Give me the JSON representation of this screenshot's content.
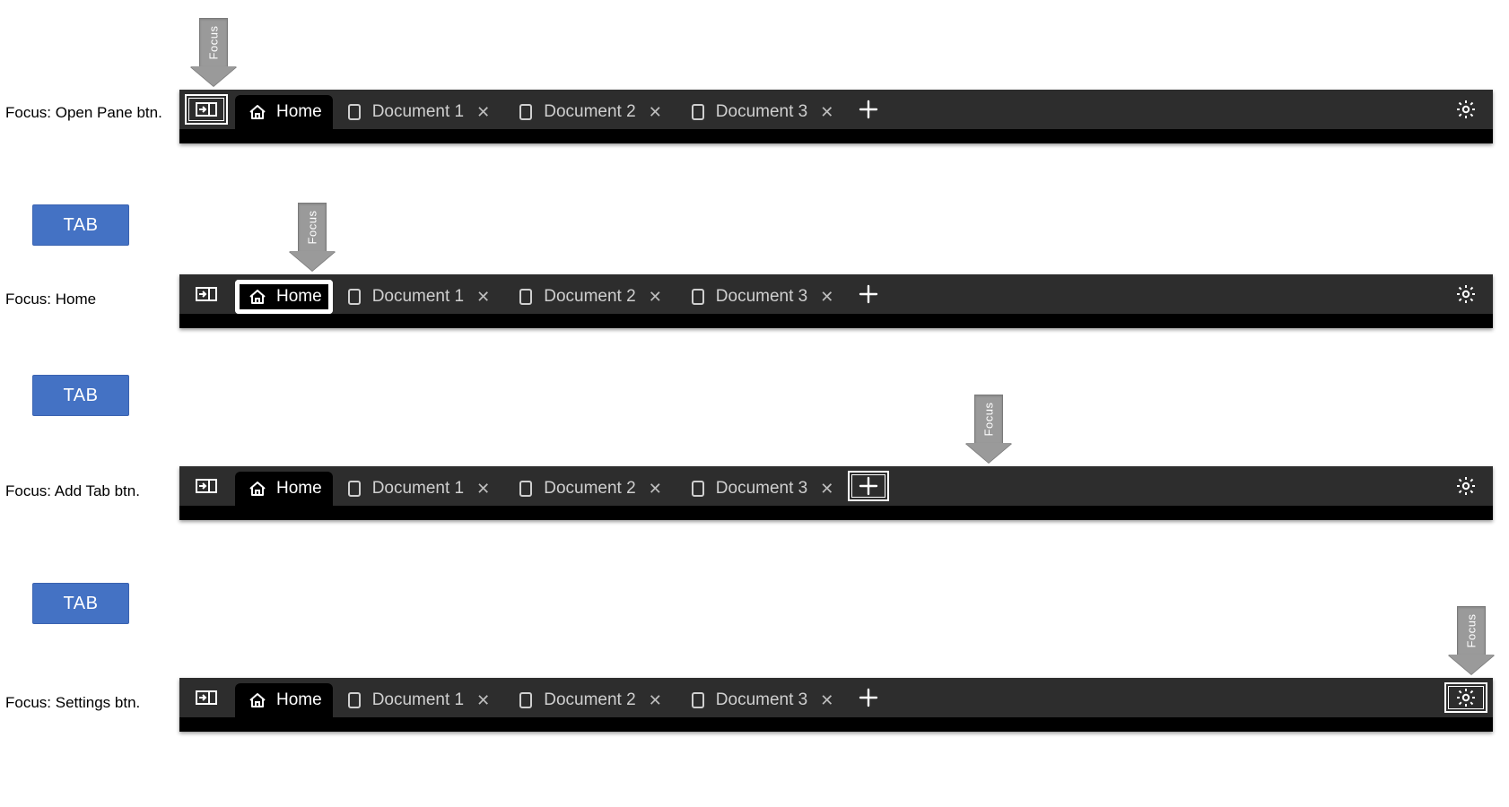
{
  "arrow_label": "Focus",
  "key_label": "TAB",
  "steps": [
    {
      "caption": "Focus: Open Pane btn.",
      "focus": "open-pane",
      "show_key": false
    },
    {
      "caption": "Focus: Home",
      "focus": "home",
      "show_key": true
    },
    {
      "caption": "Focus: Add Tab btn.",
      "focus": "add-tab",
      "show_key": true
    },
    {
      "caption": "Focus: Settings btn.",
      "focus": "settings",
      "show_key": true
    }
  ],
  "tabs": {
    "home": "Home",
    "items": [
      {
        "label": "Document 1"
      },
      {
        "label": "Document 2"
      },
      {
        "label": "Document 3"
      }
    ]
  },
  "icons": {
    "open_pane": "open-pane-icon",
    "home": "home-icon",
    "doc": "document-icon",
    "close": "close-icon",
    "add": "plus-icon",
    "settings": "gear-icon"
  }
}
